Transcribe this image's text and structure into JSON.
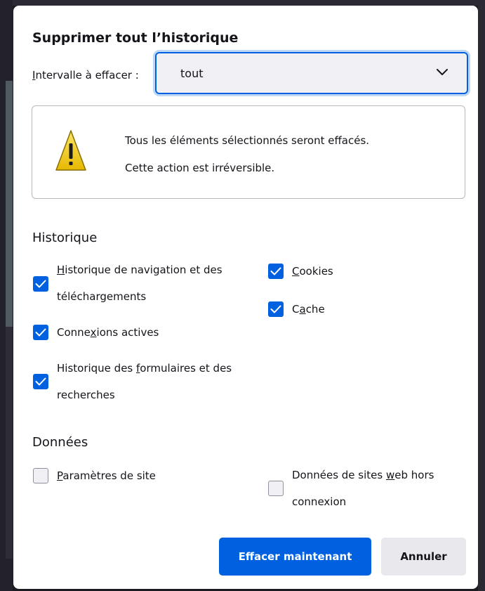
{
  "dialog": {
    "title": "Supprimer tout l’historique",
    "range": {
      "label_underlined": "I",
      "label_rest": "ntervalle à effacer :",
      "selected_value": "tout"
    },
    "warning": {
      "icon": "warning-triangle-icon",
      "line1": "Tous les éléments sélectionnés seront effacés.",
      "line2": "Cette action est irréversible."
    },
    "history_section": {
      "title": "Historique",
      "browsing": {
        "checked": true,
        "line1_underlined": "H",
        "line1_rest": "istorique de navigation et des",
        "line2": "téléchargements"
      },
      "cookies": {
        "checked": true,
        "underlined": "C",
        "rest": "ookies"
      },
      "cache": {
        "checked": true,
        "pre": "C",
        "underlined": "a",
        "rest": "che"
      },
      "connections": {
        "checked": true,
        "pre": "Conne",
        "underlined": "x",
        "rest": "ions actives"
      },
      "forms": {
        "checked": true,
        "line1_pre": "Historique des ",
        "line1_underlined": "f",
        "line1_rest": "ormulaires et des",
        "line2": "recherches"
      }
    },
    "data_section": {
      "title": "Données",
      "site_settings": {
        "checked": false,
        "underlined": "P",
        "rest": "aramètres de site"
      },
      "offline_data": {
        "checked": false,
        "line1_pre": "Données de sites ",
        "line1_underlined": "w",
        "line1_rest": "eb hors",
        "line2": "connexion"
      }
    },
    "buttons": {
      "confirm": "Effacer maintenant",
      "cancel": "Annuler"
    }
  },
  "colors": {
    "accent": "#0061e0",
    "warning_yellow": "#f5d31e"
  }
}
